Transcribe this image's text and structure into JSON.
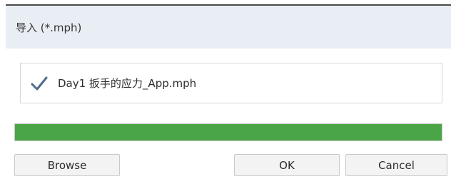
{
  "dialog": {
    "title": "导入 (*.mph)",
    "file": {
      "icon": "checkmark-icon",
      "name": "Day1 扳手的应力_App.mph"
    },
    "progress": {
      "fraction": 1.0,
      "fill_color": "#4aa547"
    },
    "buttons": {
      "browse": "Browse",
      "ok": "OK",
      "cancel": "Cancel"
    }
  }
}
